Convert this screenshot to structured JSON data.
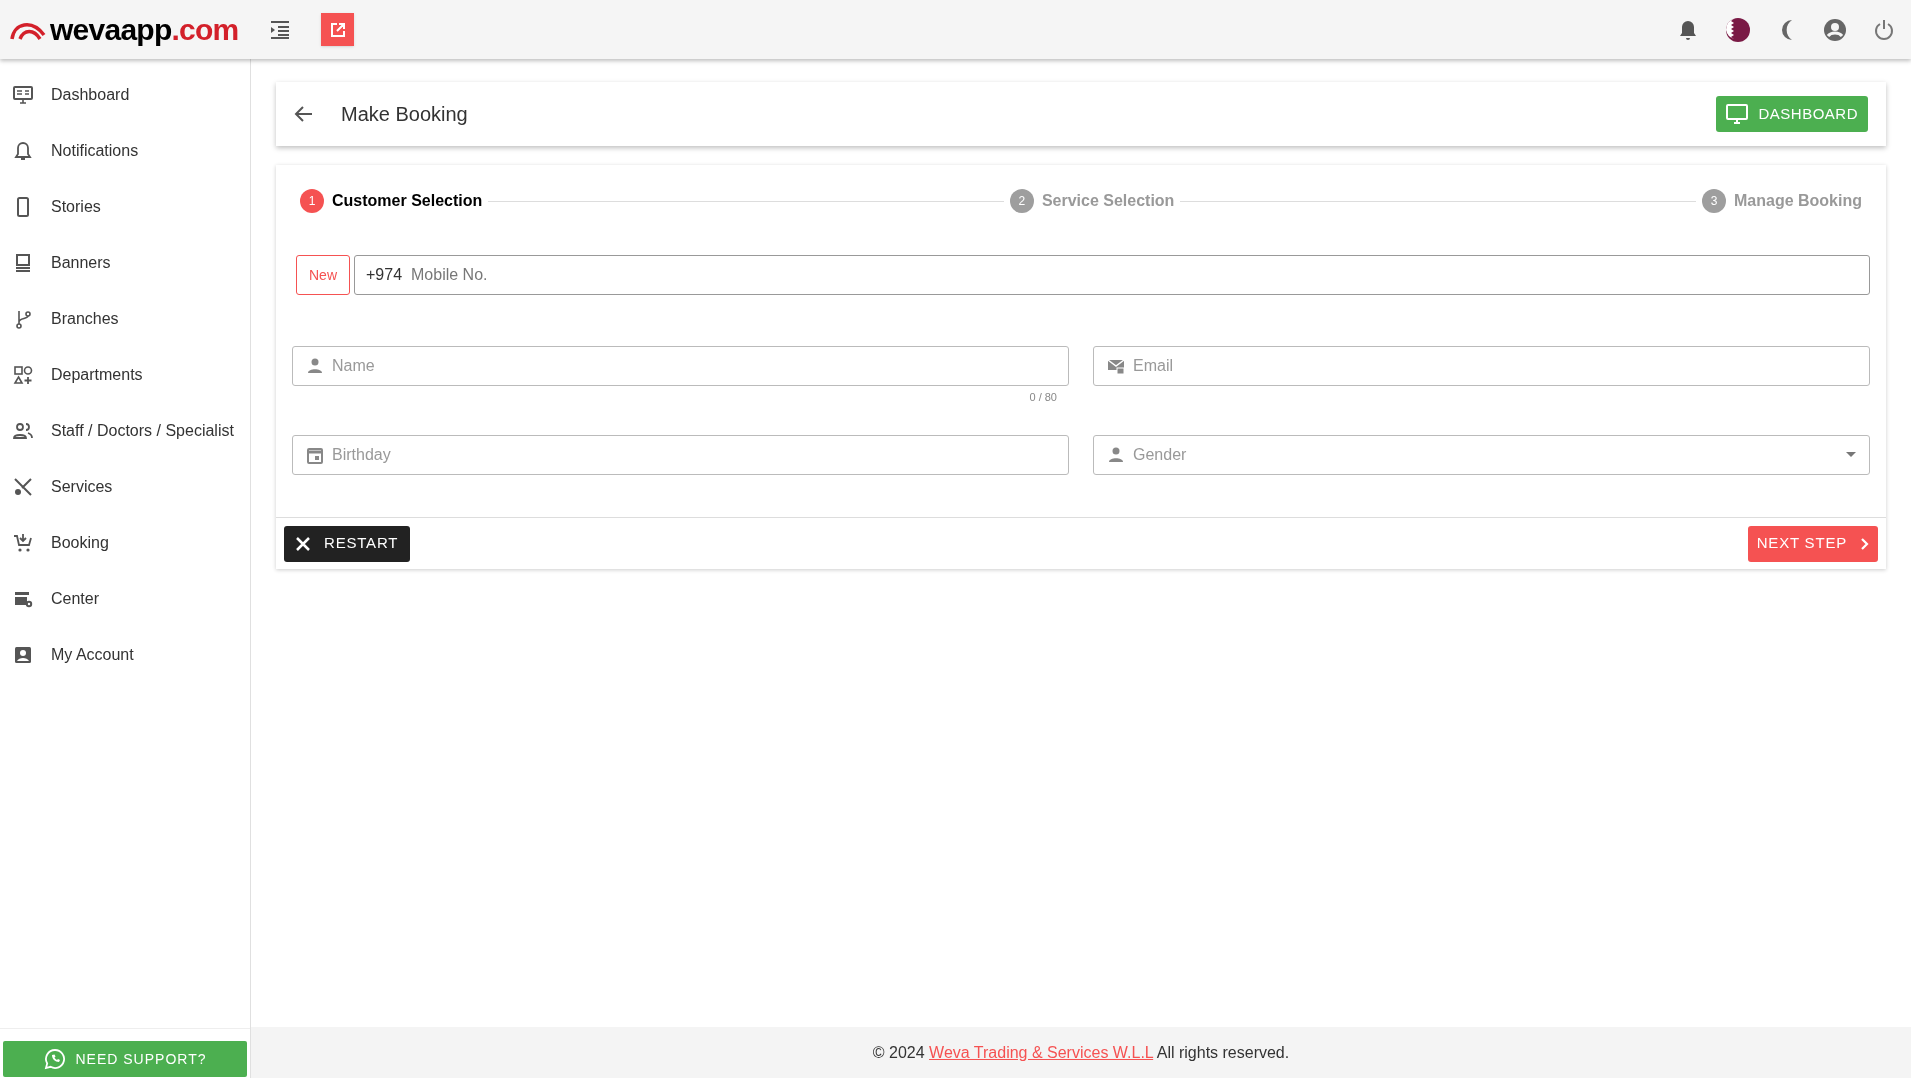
{
  "header": {
    "logo_main": "wevaapp",
    "logo_suffix": ".com"
  },
  "sidebar": {
    "items": [
      {
        "label": "Dashboard"
      },
      {
        "label": "Notifications"
      },
      {
        "label": "Stories"
      },
      {
        "label": "Banners"
      },
      {
        "label": "Branches"
      },
      {
        "label": "Departments"
      },
      {
        "label": "Staff / Doctors / Specialist"
      },
      {
        "label": "Services"
      },
      {
        "label": "Booking"
      },
      {
        "label": "Center"
      },
      {
        "label": "My Account"
      }
    ],
    "support_button": "NEED SUPPORT?"
  },
  "page": {
    "title": "Make Booking",
    "dashboard_button": "DASHBOARD"
  },
  "stepper": {
    "steps": [
      {
        "number": "1",
        "label": "Customer Selection",
        "selected": true
      },
      {
        "number": "2",
        "label": "Service Selection",
        "selected": false
      },
      {
        "number": "3",
        "label": "Manage Booking",
        "selected": false
      }
    ]
  },
  "form": {
    "new_button": "New",
    "mobile": {
      "prefix": "+974",
      "placeholder": "Mobile No."
    },
    "fields": [
      {
        "kind": "text",
        "placeholder": "Name",
        "counter": "0 / 80"
      },
      {
        "kind": "text",
        "placeholder": "Email"
      },
      {
        "kind": "text",
        "placeholder": "Birthday"
      },
      {
        "kind": "select",
        "placeholder": "Gender"
      }
    ],
    "restart_button": "RESTART",
    "next_button": "NEXT STEP"
  },
  "footer": {
    "prefix": "© 2024",
    "link": "Weva Trading & Services W.L.L",
    "suffix": "All rights reserved."
  }
}
